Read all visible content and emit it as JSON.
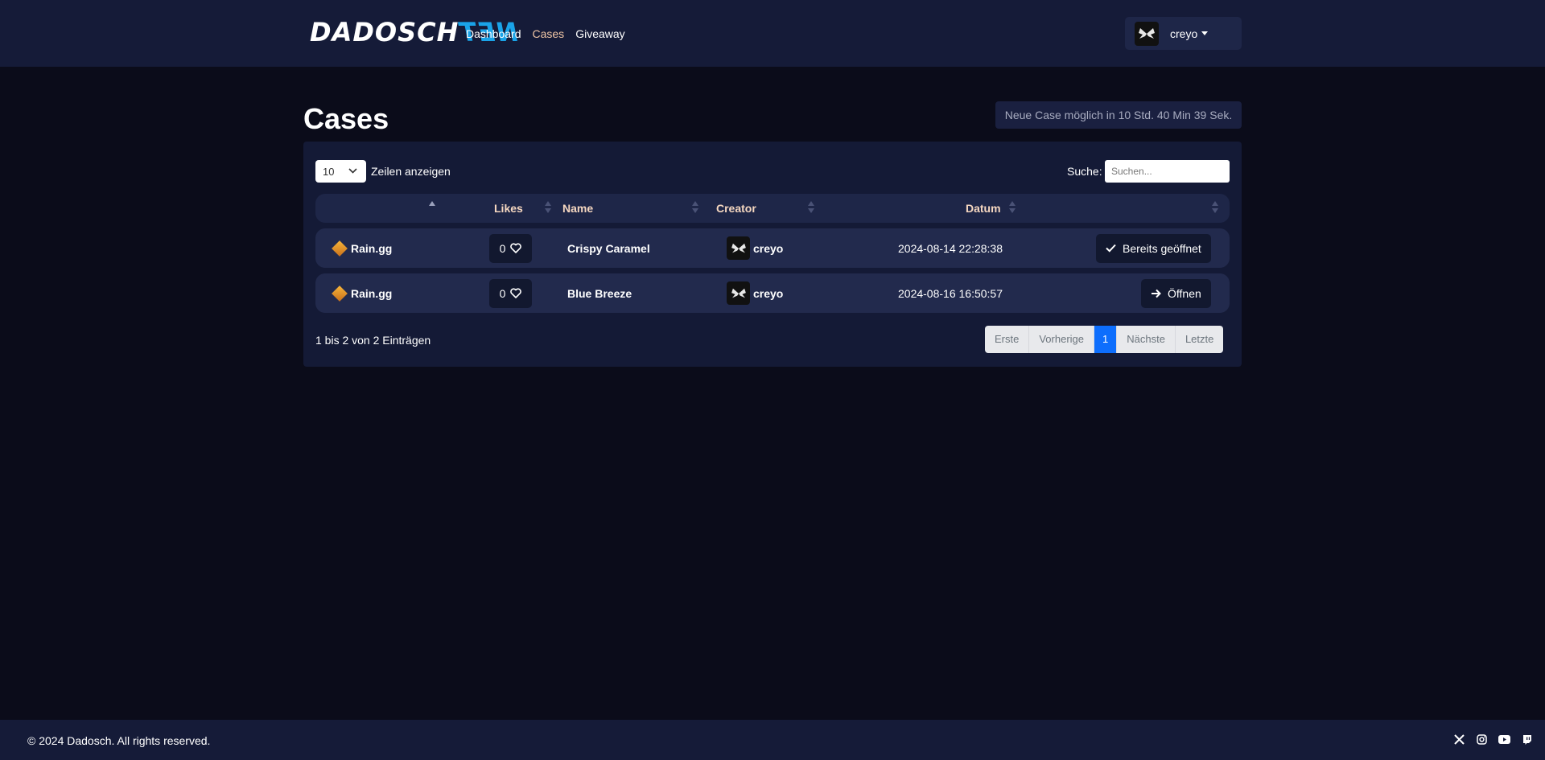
{
  "nav": {
    "brand_part1": "DADOSCH",
    "brand_part2": "NET",
    "links": [
      {
        "label": "Dashboard",
        "active": false
      },
      {
        "label": "Cases",
        "active": true
      },
      {
        "label": "Giveaway",
        "active": false
      }
    ],
    "user": {
      "name": "creyo",
      "avatar_icon": "butterfly-avatar-icon"
    }
  },
  "page": {
    "title": "Cases",
    "cooldown_text": "Neue Case möglich in 10 Std. 40 Min 39 Sek."
  },
  "table_controls": {
    "page_length_value": "10",
    "page_length_label": "Zeilen anzeigen",
    "search_label": "Suche:",
    "search_placeholder": "Suchen..."
  },
  "table": {
    "columns": [
      "",
      "Likes",
      "Name",
      "Creator",
      "Datum",
      ""
    ],
    "rows": [
      {
        "site": "Rain.gg",
        "likes": "0",
        "name": "Crispy Caramel",
        "creator": "creyo",
        "date": "2024-08-14 22:28:38",
        "action": "Bereits geöffnet",
        "action_icon": "check-icon"
      },
      {
        "site": "Rain.gg",
        "likes": "0",
        "name": "Blue Breeze",
        "creator": "creyo",
        "date": "2024-08-16 16:50:57",
        "action": "Öffnen",
        "action_icon": "arrow-right-icon"
      }
    ]
  },
  "info_text": "1 bis 2 von 2 Einträgen",
  "pagination": {
    "first": "Erste",
    "previous": "Vorherige",
    "current": "1",
    "next": "Nächste",
    "last": "Letzte"
  },
  "footer": {
    "copyright": "© 2024 Dadosch. All rights reserved.",
    "socials": [
      "x-icon",
      "instagram-icon",
      "youtube-icon",
      "twitch-icon"
    ]
  },
  "colors": {
    "background": "#0b0c1a",
    "navbar": "#151b38",
    "card": "#141a36",
    "row": "#222a4d",
    "header_text": "#f5d7c0",
    "active_nav": "#f0c6a6",
    "brand_accent": "#1aa3e8",
    "pagination_current": "#0d6efd"
  }
}
